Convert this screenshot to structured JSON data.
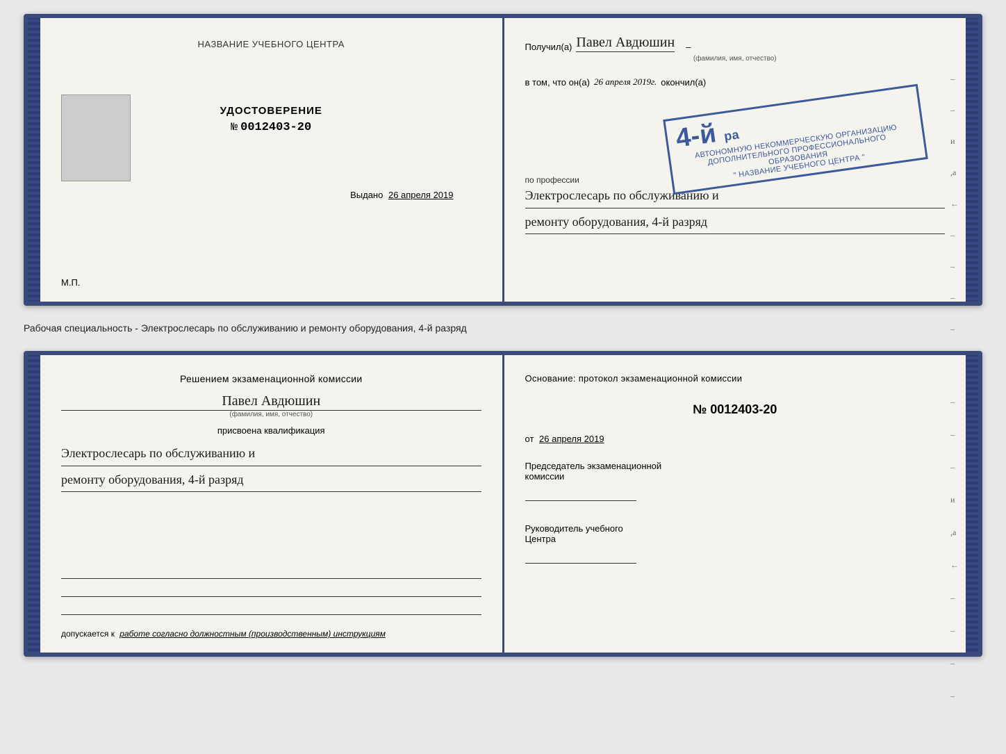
{
  "top_card": {
    "left": {
      "section_title": "НАЗВАНИЕ УЧЕБНОГО ЦЕНТРА",
      "cert_label": "УДОСТОВЕРЕНИЕ",
      "cert_number_prefix": "№",
      "cert_number": "0012403-20",
      "issued_label": "Выдано",
      "issued_date": "26 апреля 2019",
      "mp_label": "М.П."
    },
    "right": {
      "received_prefix": "Получил(а)",
      "recipient_name": "Павел Авдюшин",
      "name_sublabel": "(фамилия, имя, отчество)",
      "in_fact_prefix": "в том, что он(а)",
      "completion_date": "26 апреля 2019г.",
      "finished_label": "окончил(а)",
      "stamp_line1": "АВТОНОМНУЮ НЕКОММЕРЧЕСКУЮ ОРГАНИЗАЦИЮ",
      "stamp_line2": "ДОПОЛНИТЕЛЬНОГО ПРОФЕССИОНАЛЬНОГО ОБРАЗОВАНИЯ",
      "stamp_line3": "\" НАЗВАНИЕ УЧЕБНОГО ЦЕНТРА \"",
      "stamp_grade": "4-й",
      "stamp_suffix": "pa",
      "profession_label": "по профессии",
      "profession_name_line1": "Электрослесарь по обслуживанию и",
      "profession_name_line2": "ремонту оборудования, 4-й разряд"
    }
  },
  "separator": {
    "text": "Рабочая специальность - Электрослесарь по обслуживанию и ремонту оборудования, 4-й разряд"
  },
  "bottom_card": {
    "left": {
      "decision_line1": "Решением экзаменационной комиссии",
      "person_name": "Павел Авдюшин",
      "name_sublabel": "(фамилия, имя, отчество)",
      "assigned_label": "присвоена квалификация",
      "qualification_line1": "Электрослесарь по обслуживанию и",
      "qualification_line2": "ремонту оборудования, 4-й разряд",
      "admit_text_prefix": "допускается к",
      "admit_text_italic": "работе согласно должностным (производственным) инструкциям"
    },
    "right": {
      "basis_label": "Основание: протокол экзаменационной комиссии",
      "protocol_number_prefix": "№",
      "protocol_number": "0012403-20",
      "date_prefix": "от",
      "protocol_date": "26 апреля 2019",
      "chairman_title1": "Председатель экзаменационной",
      "chairman_title2": "комиссии",
      "director_title1": "Руководитель учебного",
      "director_title2": "Центра"
    }
  },
  "dashes": [
    "-",
    "-",
    "и",
    ",а",
    "←",
    "-",
    "-",
    "-",
    "-"
  ]
}
